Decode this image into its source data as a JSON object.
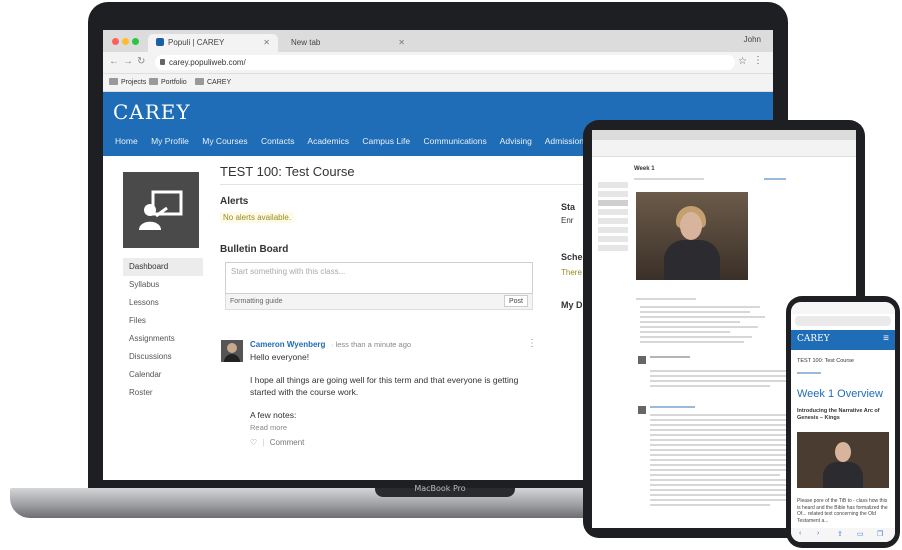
{
  "browser": {
    "tabs": [
      {
        "label": "Populi | CAREY",
        "active": true
      },
      {
        "label": "New tab",
        "active": false
      }
    ],
    "user": "John",
    "url": "carey.populiweb.com/",
    "bookmarks": [
      "Projects",
      "Portfolio",
      "CAREY"
    ]
  },
  "site": {
    "logo": "CAREY",
    "nav": [
      "Home",
      "My Profile",
      "My Courses",
      "Contacts",
      "Academics",
      "Campus Life",
      "Communications",
      "Advising",
      "Admissions"
    ]
  },
  "course": {
    "title": "TEST 100: Test Course",
    "sidebar": [
      "Dashboard",
      "Syllabus",
      "Lessons",
      "Files",
      "Assignments",
      "Discussions",
      "Calendar",
      "Roster"
    ],
    "active_sidebar": "Dashboard"
  },
  "alerts": {
    "heading": "Alerts",
    "message": "No alerts available."
  },
  "bulletin": {
    "heading": "Bulletin Board",
    "placeholder": "Start something with this class...",
    "formatting_label": "Formatting guide",
    "post_label": "Post"
  },
  "post": {
    "author": "Cameron Wyenberg",
    "time": "· less than a minute ago",
    "greeting": "Hello everyone!",
    "body": "I hope all things are going well for this term and that everyone is getting started with the course work.",
    "notes": "A few notes:",
    "read_more": "Read more",
    "comment_label": "Comment"
  },
  "right_column": [
    "Sta",
    "Enr",
    "Sche",
    "There",
    "My D"
  ],
  "laptop_brand": "MacBook Pro",
  "tablet": {
    "week_title": "Week 1"
  },
  "phone": {
    "logo": "CAREY",
    "course": "TEST 100: Test Course",
    "week_title": "Week 1 Overview",
    "intro": "Introducing the Narrative Arc of Genesis – Kings",
    "text": "Please pore of the TiB to - class how this is heard and the Bible has formalized the Of... related text concerning the Old Testament a..."
  },
  "colors": {
    "brand": "#1f6db7",
    "alert_text": "#9a8a20"
  }
}
